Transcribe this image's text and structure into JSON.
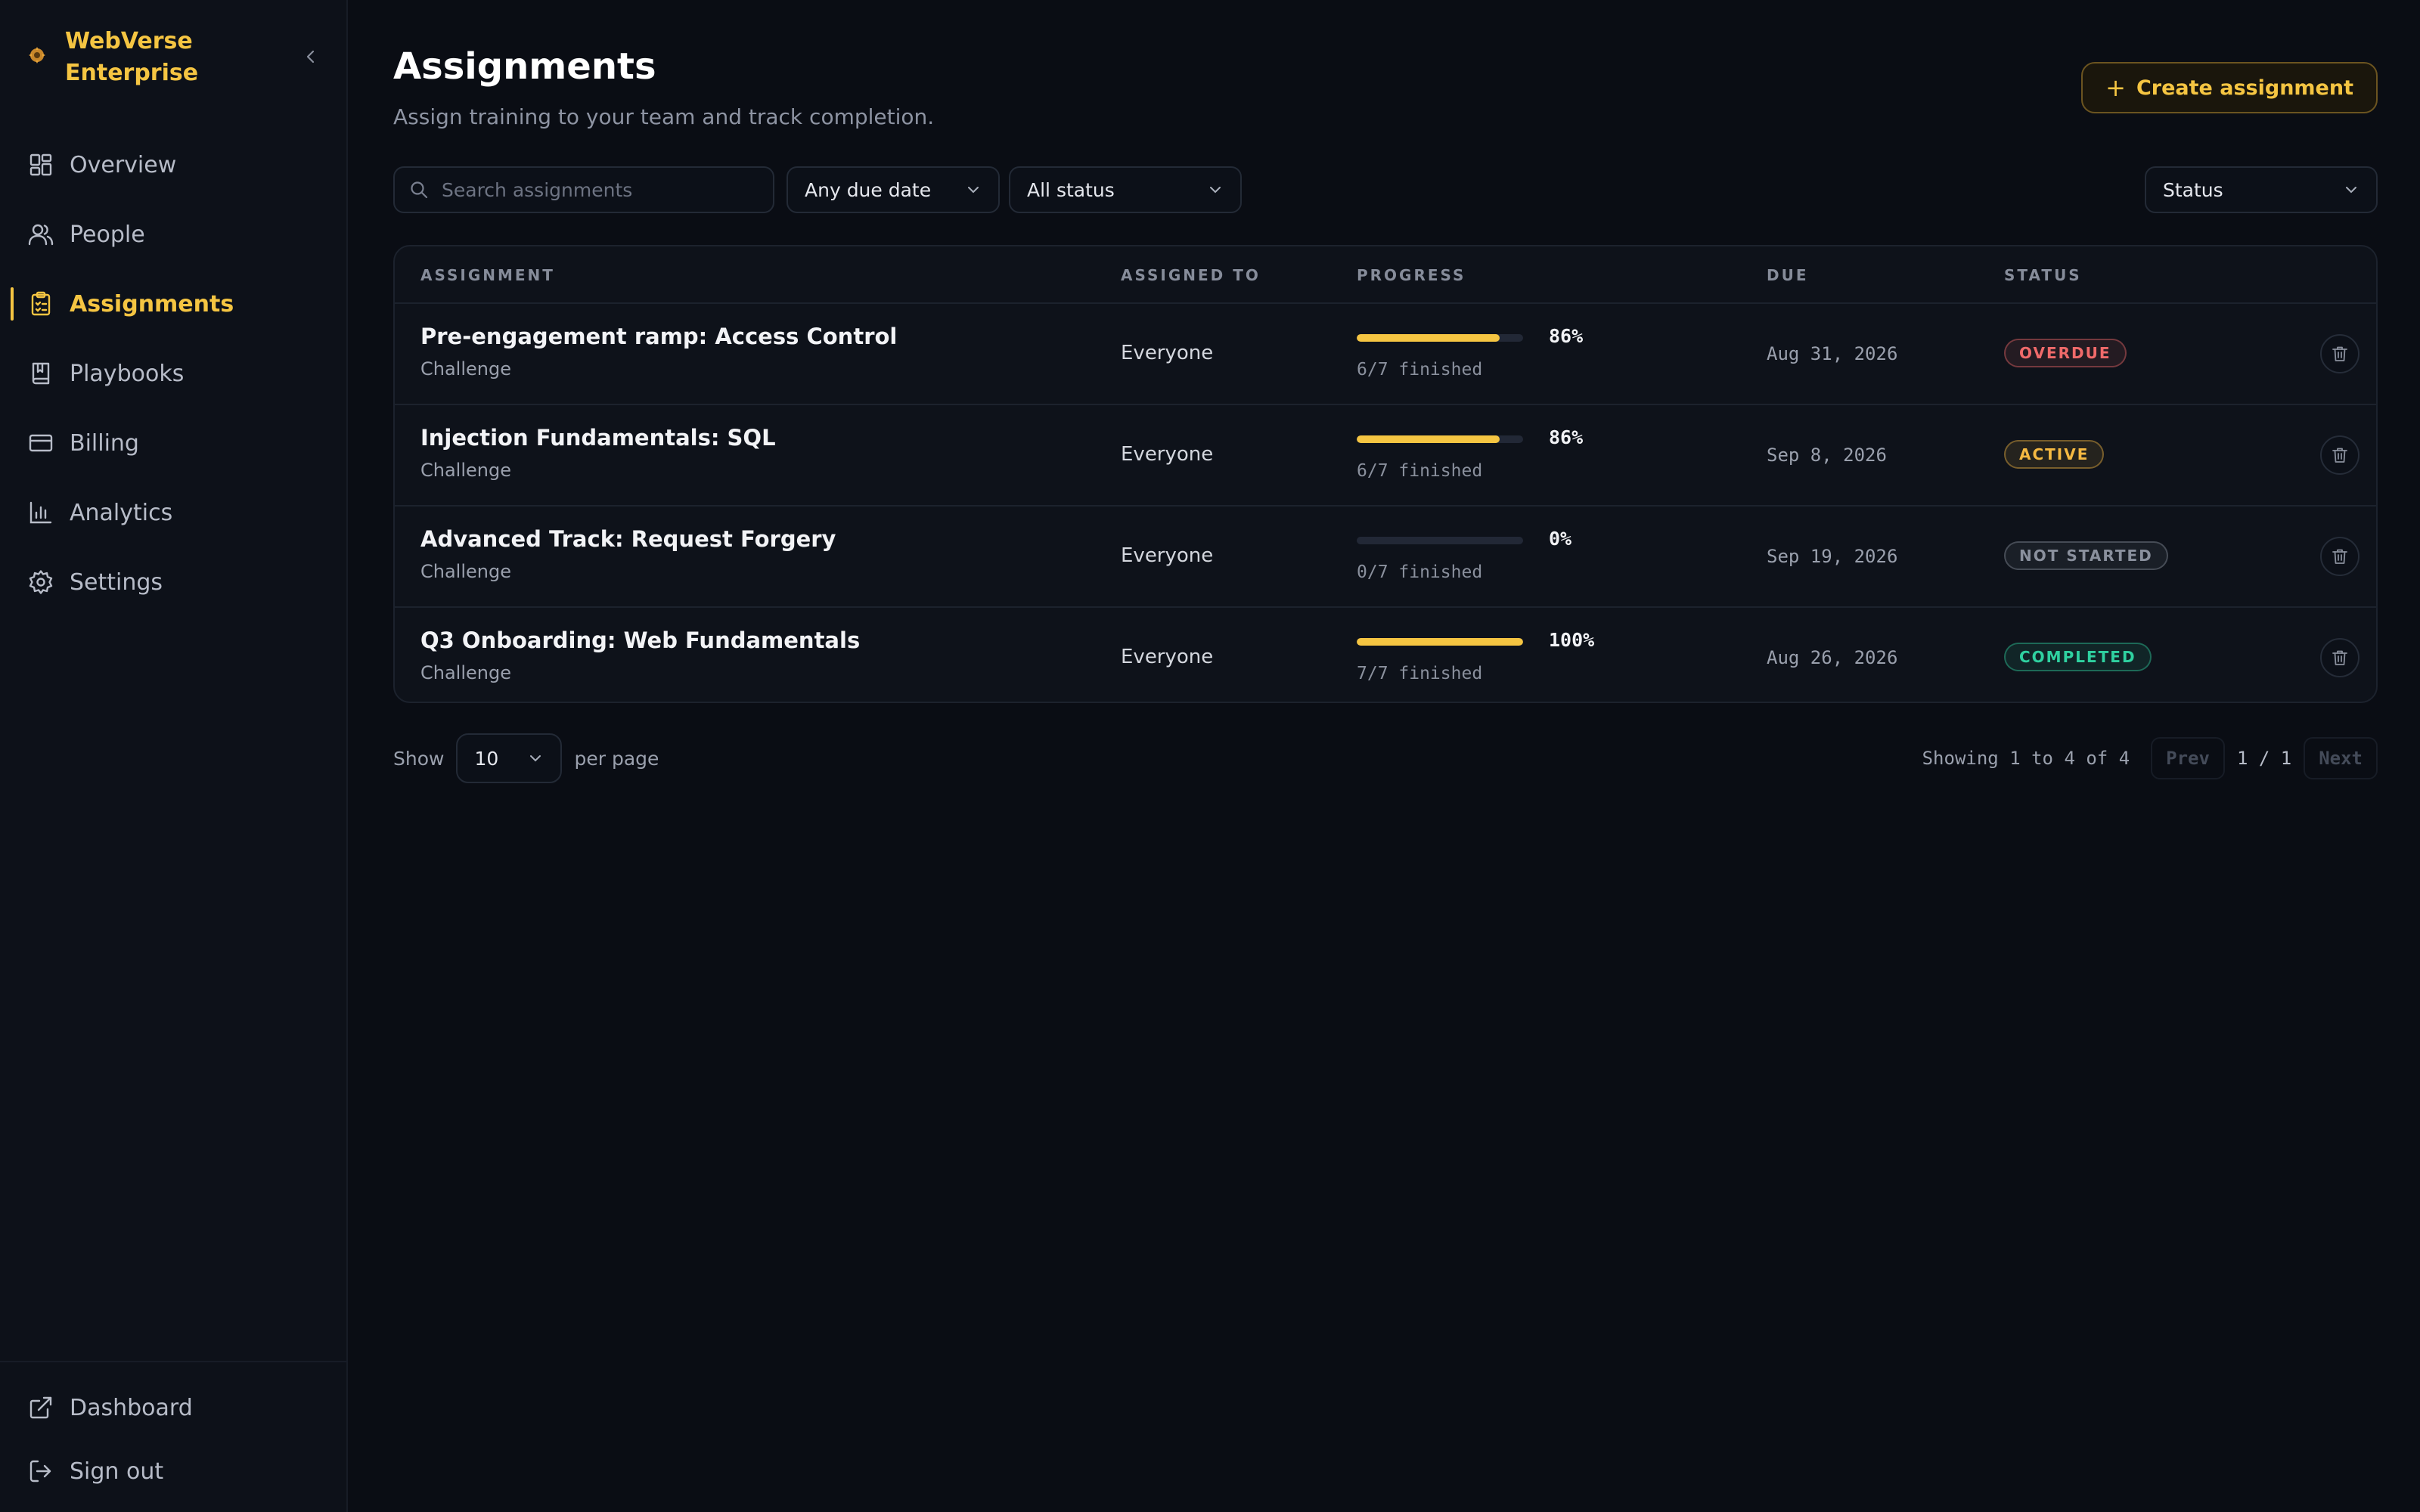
{
  "brand": {
    "name": "WebVerse Enterprise",
    "accent": "#f5c542"
  },
  "sidebar": {
    "items": [
      {
        "label": "Overview",
        "icon": "grid-icon",
        "active": false
      },
      {
        "label": "People",
        "icon": "users-icon",
        "active": false
      },
      {
        "label": "Assignments",
        "icon": "clipboard-icon",
        "active": true
      },
      {
        "label": "Playbooks",
        "icon": "book-icon",
        "active": false
      },
      {
        "label": "Billing",
        "icon": "credit-card-icon",
        "active": false
      },
      {
        "label": "Analytics",
        "icon": "bar-chart-icon",
        "active": false
      },
      {
        "label": "Settings",
        "icon": "gear-icon",
        "active": false
      }
    ],
    "bottom": [
      {
        "label": "Dashboard",
        "icon": "external-link-icon"
      },
      {
        "label": "Sign out",
        "icon": "log-out-icon"
      }
    ]
  },
  "header": {
    "title": "Assignments",
    "subtitle": "Assign training to your team and track completion.",
    "create_label": "Create assignment"
  },
  "filters": {
    "search_placeholder": "Search assignments",
    "due_value": "Any due date",
    "status_value": "All status",
    "sort_value": "Status"
  },
  "table": {
    "columns": [
      "ASSIGNMENT",
      "ASSIGNED TO",
      "PROGRESS",
      "DUE",
      "STATUS"
    ],
    "rows": [
      {
        "title": "Pre-engagement ramp: Access Control",
        "type": "Challenge",
        "assigned_to": "Everyone",
        "progress": 86,
        "progress_label": "86%",
        "finished": "6/7 finished",
        "due": "Aug 31, 2026",
        "status": "OVERDUE",
        "status_color": "#f06a6a"
      },
      {
        "title": "Injection Fundamentals: SQL",
        "type": "Challenge",
        "assigned_to": "Everyone",
        "progress": 86,
        "progress_label": "86%",
        "finished": "6/7 finished",
        "due": "Sep 8, 2026",
        "status": "ACTIVE",
        "status_color": "#f5b942"
      },
      {
        "title": "Advanced Track: Request Forgery",
        "type": "Challenge",
        "assigned_to": "Everyone",
        "progress": 0,
        "progress_label": "0%",
        "finished": "0/7 finished",
        "due": "Sep 19, 2026",
        "status": "NOT STARTED",
        "status_color": "#8a909d"
      },
      {
        "title": "Q3 Onboarding: Web Fundamentals",
        "type": "Challenge",
        "assigned_to": "Everyone",
        "progress": 100,
        "progress_label": "100%",
        "finished": "7/7 finished",
        "due": "Aug 26, 2026",
        "status": "COMPLETED",
        "status_color": "#2fd1a0"
      }
    ]
  },
  "pagination": {
    "show_label": "Show",
    "per_page_value": "10",
    "per_page_label": "per page",
    "showing": "Showing 1 to 4 of 4",
    "prev": "Prev",
    "page": "1 / 1",
    "next": "Next"
  }
}
